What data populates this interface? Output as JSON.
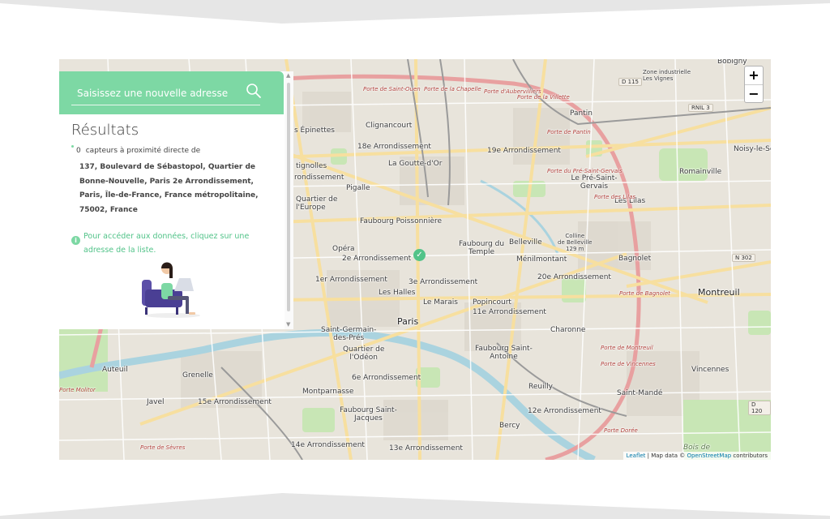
{
  "search": {
    "placeholder": "Saisissez une nouvelle adresse"
  },
  "results": {
    "title": "Résultats",
    "count": "0",
    "count_suffix": "capteurs à proximité directe de",
    "address": "137, Boulevard de Sébastopol, Quartier de Bonne-Nouvelle, Paris 2e Arrondissement, Paris, Île-de-France, France métropolitaine, 75002, France",
    "info": "Pour accéder aux données, cliquez sur une adresse de la liste."
  },
  "map": {
    "zoom_in": "+",
    "zoom_out": "−",
    "attribution_leaflet": "Leaflet",
    "attribution_text": " | Map data © ",
    "attribution_osm": "OpenStreetMap",
    "attribution_tail": " contributors",
    "labels": {
      "bobigny": "Bobigny",
      "pantin": "Pantin",
      "noisy": "Noisy-le-Se",
      "romainville": "Romainville",
      "pre_st_gervais": "Le Pré-Saint-Gervais",
      "les_lilas": "Les Lilas",
      "bagnolet": "Bagnolet",
      "montreuil": "Montreuil",
      "vincennes": "Vincennes",
      "saint_mande": "Saint-Mandé",
      "clignancourt": "Clignancourt",
      "arr18": "18e Arrondissement",
      "arr19": "19e Arrondissement",
      "goutte_dor": "La Goutte-d'Or",
      "epinettes": "s Épinettes",
      "batignolles": "tignolles",
      "arr_8": "rondissement",
      "pigalle": "Pigalle",
      "quartier_europe_1": "Quartier de",
      "quartier_europe_2": "l'Europe",
      "faubourg_poissonniere": "Faubourg Poissonnière",
      "belleville": "Belleville",
      "colline_1": "Colline",
      "colline_2": "de Belleville",
      "colline_3": "129 m",
      "faubourg_temple_1": "Faubourg du",
      "faubourg_temple_2": "Temple",
      "opera": "Opéra",
      "arr2": "2e Arrondissement",
      "menilmontant": "Ménilmontant",
      "arr20": "20e Arrondissement",
      "arr1": "1er Arrondissement",
      "arr3": "3e Arrondissement",
      "les_halles": "Les Halles",
      "le_marais": "Le Marais",
      "popincourt": "Popincourt",
      "arr11": "11e Arrondissement",
      "paris": "Paris",
      "charonne": "Charonne",
      "st_germain_1": "Saint-Germain-",
      "st_germain_2": "des-Prés",
      "odeon_1": "Quartier de",
      "odeon_2": "l'Odéon",
      "faubourg_antoine_1": "Faubourg Saint-",
      "faubourg_antoine_2": "Antoine",
      "auteuil": "Auteuil",
      "grenelle": "Grenelle",
      "arr6": "6e Arrondissement",
      "reuilly": "Reuilly",
      "javel": "Javel",
      "arr15": "15e Arrondissement",
      "montparnasse": "Montparnasse",
      "faubourg_jacques_1": "Faubourg Saint-",
      "faubourg_jacques_2": "Jacques",
      "arr12": "12e Arrondissement",
      "bercy": "Bercy",
      "arr14": "14e Arrondissement",
      "arr13": "13e Arrondissement",
      "bois": "Bois de",
      "zone_ind_1": "Zone industrielle",
      "zone_ind_2": "Les Vignes",
      "porte_pantin": "Porte de Pantin",
      "porte_lilas": "Porte des Lilas",
      "porte_bagnolet": "Porte de Bagnolet",
      "porte_montreuil": "Porte de Montreuil",
      "porte_vincennes": "Porte de Vincennes",
      "porte_doree": "Porte Dorée",
      "porte_sevres": "Porte de Sèvres",
      "porte_molitor": "Porte Molitor",
      "porte_villette": "Porte de la Villette",
      "porte_chapelle": "Porte de la Chapelle",
      "porte_aubervilliers": "Porte d'Aubervilliers",
      "porte_st_ouen": "Porte de Saint-Ouen",
      "porte_pres_st_gervais": "Porte du Pré-Saint-Gervais"
    },
    "badges": {
      "d115": "D 115",
      "rnil3": "RNIL 3",
      "n302": "N 302",
      "d120": "D 120"
    }
  }
}
